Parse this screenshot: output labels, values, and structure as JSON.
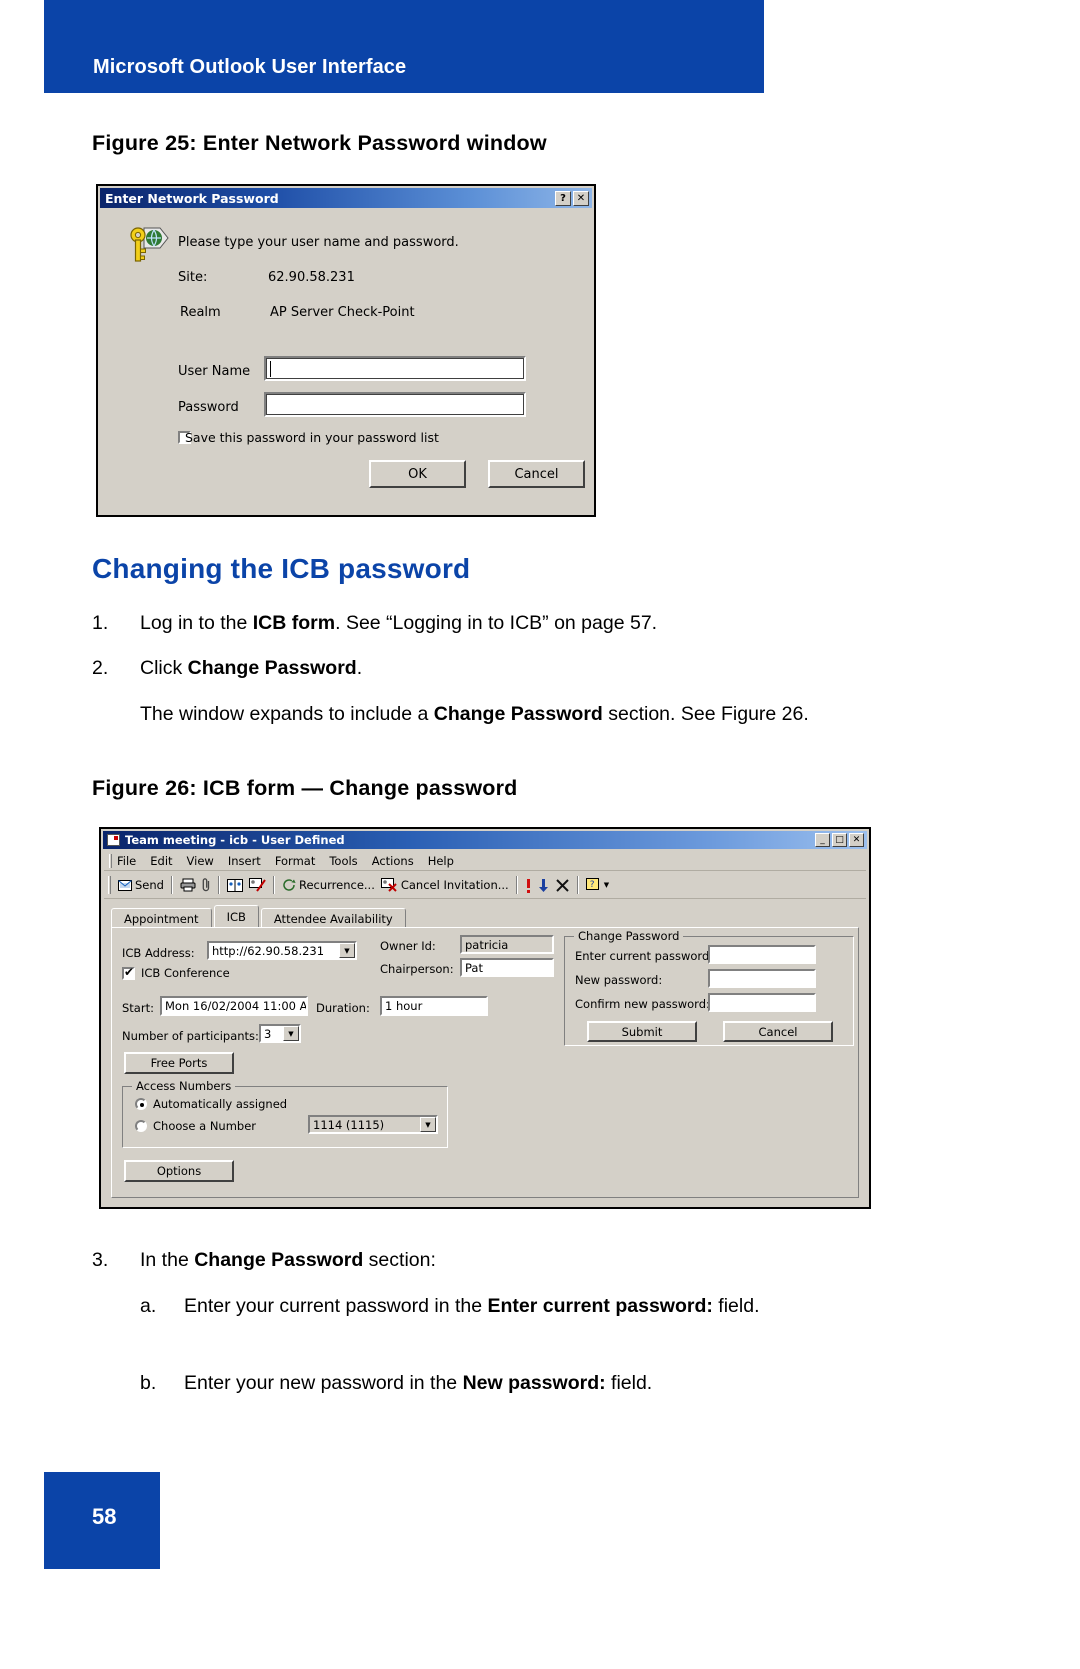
{
  "page": {
    "header_title": "Microsoft Outlook User Interface",
    "page_number": "58",
    "accent_color": "#0B44A8"
  },
  "figure25": {
    "caption": "Figure 25: Enter Network Password window",
    "dialog": {
      "title": "Enter Network Password",
      "help_button": "?",
      "close_button": "✕",
      "icon": "key-globe-icon",
      "prompt": "Please type your user name and password.",
      "site_label": "Site:",
      "site_value": "62.90.58.231",
      "realm_label": "Realm",
      "realm_value": "AP Server Check-Point",
      "user_name_label": "User Name",
      "user_name_value": "",
      "password_label": "Password",
      "password_value": "",
      "save_checkbox_label": "Save this password in your password list",
      "save_checkbox_checked": false,
      "ok_label": "OK",
      "cancel_label": "Cancel"
    }
  },
  "section": {
    "heading": "Changing the ICB password",
    "steps": [
      {
        "num": "1.",
        "text_html": "Log in to the <b>ICB form</b>. See “Logging in to ICB” on page 57."
      },
      {
        "num": "2.",
        "text_html": "Click <b>Change Password</b>."
      }
    ],
    "step2_note_html": "The window expands to include a <b>Change Password</b> section. See Figure 26.",
    "step3": {
      "num": "3.",
      "text_html": "In the <b>Change Password</b> section:"
    },
    "step3_sub": [
      {
        "num": "a.",
        "text_html": "Enter your current password in the <b>Enter current password:</b> field."
      },
      {
        "num": "b.",
        "text_html": "Enter your new password in the <b>New password:</b> field."
      }
    ]
  },
  "figure26": {
    "caption": "Figure 26: ICB form — Change password",
    "window": {
      "title": "Team meeting - icb   - User Defined",
      "minimize": "_",
      "maximize": "□",
      "close": "✕",
      "menus": [
        "File",
        "Edit",
        "View",
        "Insert",
        "Format",
        "Tools",
        "Actions",
        "Help"
      ],
      "toolbar": [
        {
          "name": "send-button",
          "label": "Send",
          "icon": "envelope-icon"
        },
        {
          "name": "print-button",
          "label": "",
          "icon": "printer-icon"
        },
        {
          "name": "attach-button",
          "label": "",
          "icon": "paperclip-icon"
        },
        {
          "name": "address-book-button",
          "label": "",
          "icon": "address-book-icon"
        },
        {
          "name": "check-names-button",
          "label": "",
          "icon": "check-names-icon"
        },
        {
          "name": "recurrence-button",
          "label": "Recurrence...",
          "icon": "recurrence-icon"
        },
        {
          "name": "cancel-invitation-button",
          "label": "Cancel Invitation...",
          "icon": "cancel-invitation-icon"
        },
        {
          "name": "importance-high-button",
          "label": "",
          "icon": "exclamation-icon"
        },
        {
          "name": "importance-low-button",
          "label": "",
          "icon": "down-arrow-icon"
        },
        {
          "name": "delete-button",
          "label": "",
          "icon": "x-icon"
        },
        {
          "name": "help-button",
          "label": "",
          "icon": "help-icon"
        }
      ],
      "tabs": [
        {
          "label": "Appointment",
          "active": false
        },
        {
          "label": "ICB",
          "active": true
        },
        {
          "label": "Attendee Availability",
          "active": false
        }
      ],
      "form": {
        "icb_address_label": "ICB Address:",
        "icb_address_value": "http://62.90.58.231",
        "icb_conference_label": "ICB Conference",
        "icb_conference_checked": true,
        "owner_id_label": "Owner Id:",
        "owner_id_value": "patricia",
        "chairperson_label": "Chairperson:",
        "chairperson_value": "Pat",
        "start_label": "Start:",
        "start_value": "Mon 16/02/2004 11:00 A",
        "duration_label": "Duration:",
        "duration_value": "1 hour",
        "participants_label": "Number of participants:",
        "participants_value": "3",
        "free_ports_label": "Free Ports",
        "options_label": "Options",
        "access_numbers_title": "Access Numbers",
        "auto_assigned_label": "Automatically assigned",
        "auto_assigned_selected": true,
        "choose_number_label": "Choose a Number",
        "choose_number_selected": false,
        "choose_number_value": "1114 (1115)"
      },
      "change_password": {
        "title": "Change Password",
        "current_label": "Enter current password:",
        "current_value": "",
        "new_label": "New password:",
        "new_value": "",
        "confirm_label": "Confirm new password:",
        "confirm_value": "",
        "submit_label": "Submit",
        "cancel_label": "Cancel"
      }
    }
  }
}
